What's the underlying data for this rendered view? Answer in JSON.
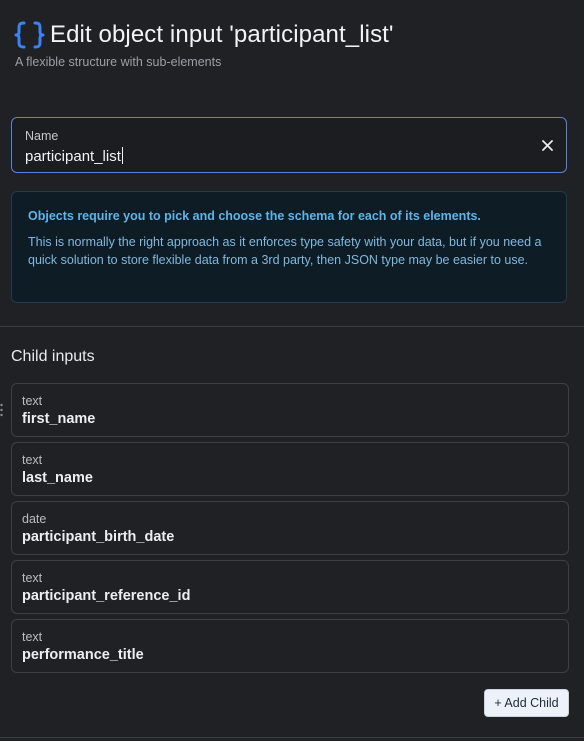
{
  "header": {
    "icon": "curly-braces-icon",
    "title": "Edit object input 'participant_list'",
    "subtitle": "A flexible structure with sub-elements"
  },
  "name_field": {
    "label": "Name",
    "value": "participant_list",
    "clear_icon": "close-icon"
  },
  "info": {
    "title": "Objects require you to pick and choose the schema for each of its elements.",
    "body": "This is normally the right approach as it enforces type safety with your data, but if you need a quick solution to store flexible data from a 3rd party, then JSON type may be easier to use."
  },
  "children_section": {
    "title": "Child inputs",
    "items": [
      {
        "type": "text",
        "name": "first_name"
      },
      {
        "type": "text",
        "name": "last_name"
      },
      {
        "type": "date",
        "name": "participant_birth_date"
      },
      {
        "type": "text",
        "name": "participant_reference_id"
      },
      {
        "type": "text",
        "name": "performance_title"
      }
    ],
    "add_button_label": "+ Add Child"
  },
  "colors": {
    "background": "#1f2125",
    "accent": "#3b82f6",
    "info_background": "#0e1c25",
    "info_text": "#7fb9e0"
  }
}
